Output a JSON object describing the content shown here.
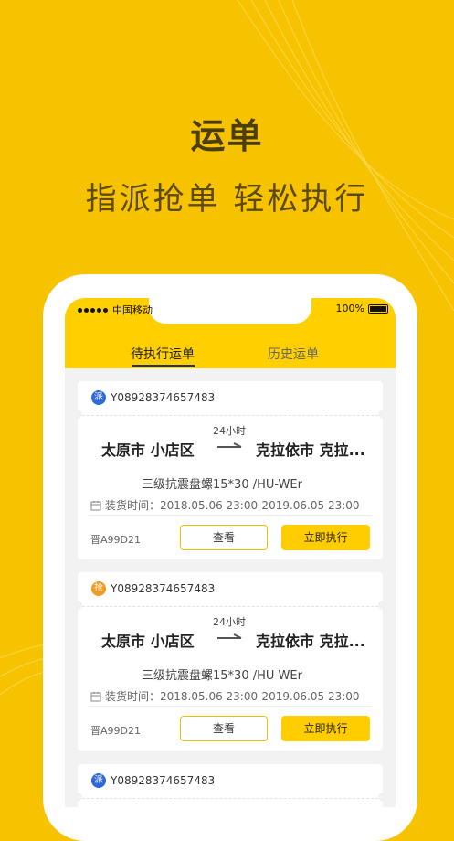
{
  "hero": {
    "title": "运单",
    "subtitle": "指派抢单  轻松执行"
  },
  "status_bar": {
    "carrier": "中国移动",
    "battery": "100%"
  },
  "tabs": [
    {
      "label": "待执行运单",
      "active": true
    },
    {
      "label": "历史运单",
      "active": false
    }
  ],
  "orders": [
    {
      "badge": "派",
      "badge_color": "#2d6ad6",
      "order_no": "Y08928374657483",
      "from": "太原市 小店区",
      "to": "克拉依市 克拉...",
      "duration": "24小时",
      "cargo": "三级抗震盘螺15*30 /HU-WEr",
      "load_time": "装货时间：2018.05.06 23:00-2019.06.05 23:00",
      "plate": "晋A99D21",
      "view_label": "查看",
      "exec_label": "立即执行"
    },
    {
      "badge": "抢",
      "badge_color": "#f39a1e",
      "order_no": "Y08928374657483",
      "from": "太原市 小店区",
      "to": "克拉依市 克拉...",
      "duration": "24小时",
      "cargo": "三级抗震盘螺15*30 /HU-WEr",
      "load_time": "装货时间：2018.05.06 23:00-2019.06.05 23:00",
      "plate": "晋A99D21",
      "view_label": "查看",
      "exec_label": "立即执行"
    },
    {
      "badge": "派",
      "badge_color": "#2d6ad6",
      "order_no": "Y08928374657483"
    }
  ]
}
